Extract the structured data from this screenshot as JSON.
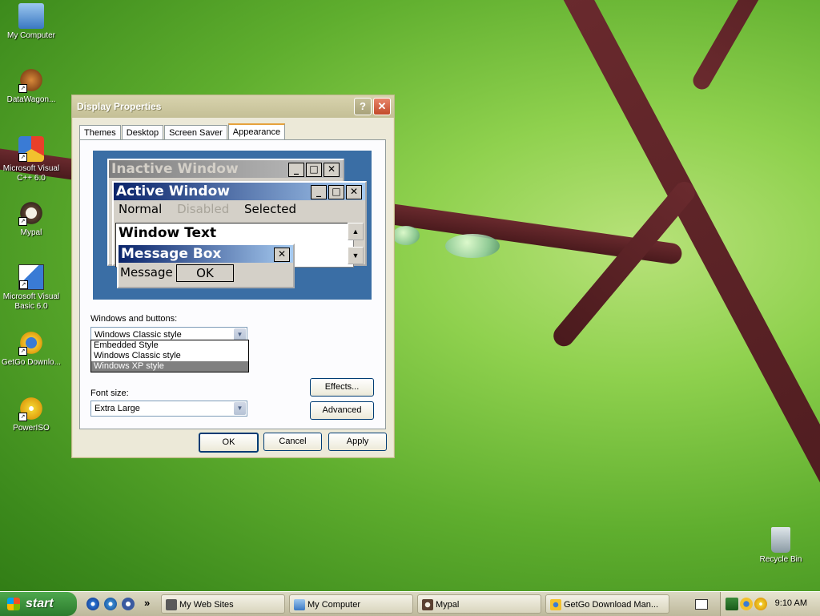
{
  "desktop": {
    "icons": [
      {
        "label": "My Computer",
        "icon": "my-computer-icon"
      },
      {
        "label": "DataWagon...",
        "icon": "datawagon-icon"
      },
      {
        "label": "Microsoft Visual C++ 6.0",
        "icon": "visual-cpp-icon"
      },
      {
        "label": "Mypal",
        "icon": "mypal-icon"
      },
      {
        "label": "Microsoft Visual Basic 6.0",
        "icon": "visual-basic-icon"
      },
      {
        "label": "GetGo Downlo...",
        "icon": "getgo-icon"
      },
      {
        "label": "PowerISO",
        "icon": "poweriso-icon"
      },
      {
        "label": "Recycle Bin",
        "icon": "recycle-bin-icon"
      }
    ]
  },
  "dialog": {
    "title": "Display Properties",
    "help_glyph": "?",
    "close_glyph": "✕",
    "tabs": [
      "Themes",
      "Desktop",
      "Screen Saver",
      "Appearance"
    ],
    "active_tab": "Appearance",
    "preview": {
      "inactive_title": "Inactive Window",
      "active_title": "Active Window",
      "menu": [
        "Normal",
        "Disabled",
        "Selected"
      ],
      "window_text": "Window Text",
      "message_box_title": "Message Box",
      "message_text": "Message T",
      "ok_label": "OK",
      "min_glyph": "_",
      "max_glyph": "□",
      "close_glyph": "✕",
      "up_glyph": "▲",
      "down_glyph": "▼"
    },
    "windows_buttons_label": "Windows and buttons:",
    "windows_buttons_value": "Windows Classic style",
    "windows_buttons_options": [
      "Embedded Style",
      "Windows Classic style",
      "Windows XP style"
    ],
    "windows_buttons_highlighted": "Windows XP style",
    "font_size_label": "Font size:",
    "font_size_value": "Extra Large",
    "combo_arrow": "▼",
    "effects_label": "Effects...",
    "advanced_label": "Advanced",
    "ok_label": "OK",
    "cancel_label": "Cancel",
    "apply_label": "Apply"
  },
  "taskbar": {
    "start_label": "start",
    "quick_launch_more": "»",
    "tasks": [
      {
        "label": "My Web Sites",
        "icon": "web-sites-icon"
      },
      {
        "label": "My Computer",
        "icon": "my-computer-icon"
      },
      {
        "label": "Mypal",
        "icon": "mypal-icon"
      },
      {
        "label": "GetGo Download Man...",
        "icon": "getgo-icon"
      }
    ],
    "clock": "9:10 AM"
  }
}
